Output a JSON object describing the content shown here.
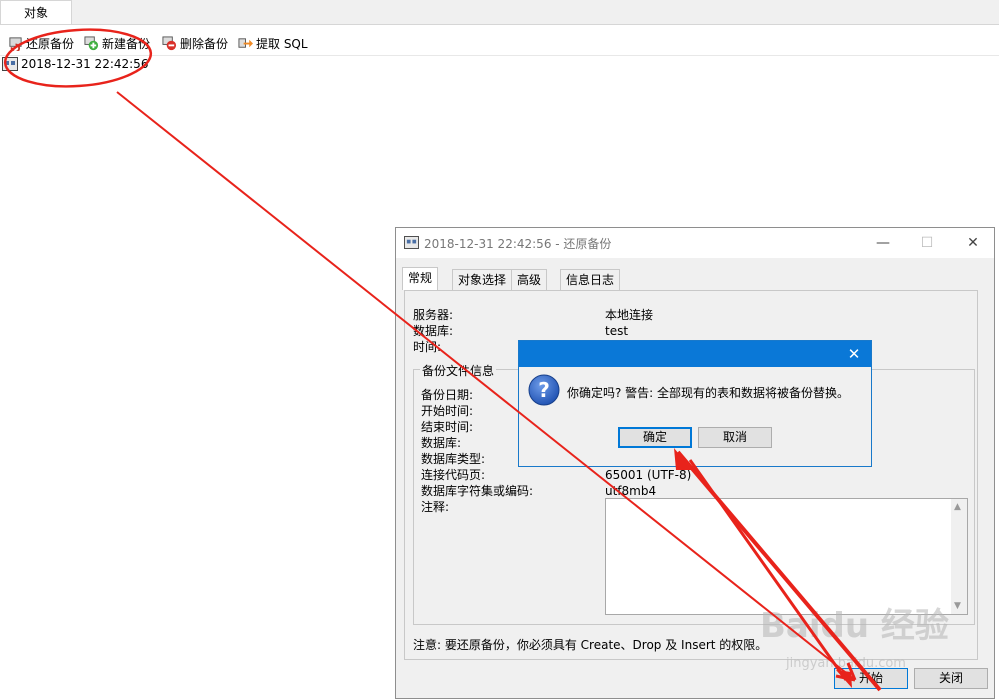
{
  "tab": {
    "label": "对象"
  },
  "toolbar": {
    "restore": "还原备份",
    "new": "新建备份",
    "delete": "删除备份",
    "extract": "提取 SQL"
  },
  "list": {
    "item": "2018-12-31 22:42:56"
  },
  "dialog": {
    "title": "2018-12-31 22:42:56 - 还原备份",
    "tabs": [
      "常规",
      "对象选择",
      "高级",
      "信息日志"
    ],
    "server_label": "服务器:",
    "server_value": "本地连接",
    "database_label": "数据库:",
    "database_value": "test",
    "time_label": "时间:",
    "group_title": "备份文件信息",
    "fields": [
      "备份日期:",
      "开始时间:",
      "结束时间:",
      "数据库:",
      "数据库类型:",
      "连接代码页:",
      "数据库字符集或编码:",
      "注释:"
    ],
    "codepage_value": "65001 (UTF-8)",
    "charset_value": "utf8mb4",
    "note": "注意: 要还原备份，你必须具有 Create、Drop 及 Insert 的权限。",
    "start_button": "开始",
    "close_button": "关闭"
  },
  "confirm": {
    "message": "你确定吗? 警告: 全部现有的表和数据将被备份替换。",
    "ok": "确定",
    "cancel": "取消"
  },
  "watermark": {
    "logo": "Baidu 经验",
    "url": "jingyan.baidu.com"
  },
  "colors": {
    "annotation": "#e8231b",
    "titlebar": "#0a78d7"
  }
}
